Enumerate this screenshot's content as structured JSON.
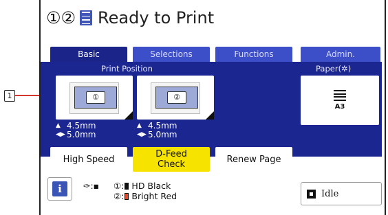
{
  "callout": {
    "number": "1",
    "line_color": "#d4342e"
  },
  "header": {
    "drums": "①②",
    "title": "Ready to Print"
  },
  "tabs": [
    {
      "label": "Basic",
      "active": true
    },
    {
      "label": "Selections",
      "active": false
    },
    {
      "label": "Functions",
      "active": false
    },
    {
      "label": "Admin.",
      "active": false
    }
  ],
  "print_position": {
    "label": "Print Position",
    "cards": [
      {
        "drum": "①",
        "vertical": "4.5mm",
        "horizontal": "5.0mm"
      },
      {
        "drum": "②",
        "vertical": "4.5mm",
        "horizontal": "5.0mm"
      }
    ]
  },
  "paper": {
    "label": "Paper(✲)",
    "size": "A3"
  },
  "buttons": [
    {
      "label": "High Speed"
    },
    {
      "label": "D-Feed Check",
      "line1": "D-Feed",
      "line2": "Check"
    },
    {
      "label": "Renew Page"
    }
  ],
  "status": {
    "info": "i",
    "ink": [
      {
        "drum": "①:",
        "name": "HD Black",
        "color": "#111111"
      },
      {
        "drum": "②:",
        "name": "Bright Red",
        "color": "#e04a2a"
      }
    ],
    "state": "Idle"
  },
  "colors": {
    "panel": "#1c2690",
    "tab": "#3d4ec9",
    "tab_active": "#1b2489",
    "yellow_button": "#f6e400"
  }
}
